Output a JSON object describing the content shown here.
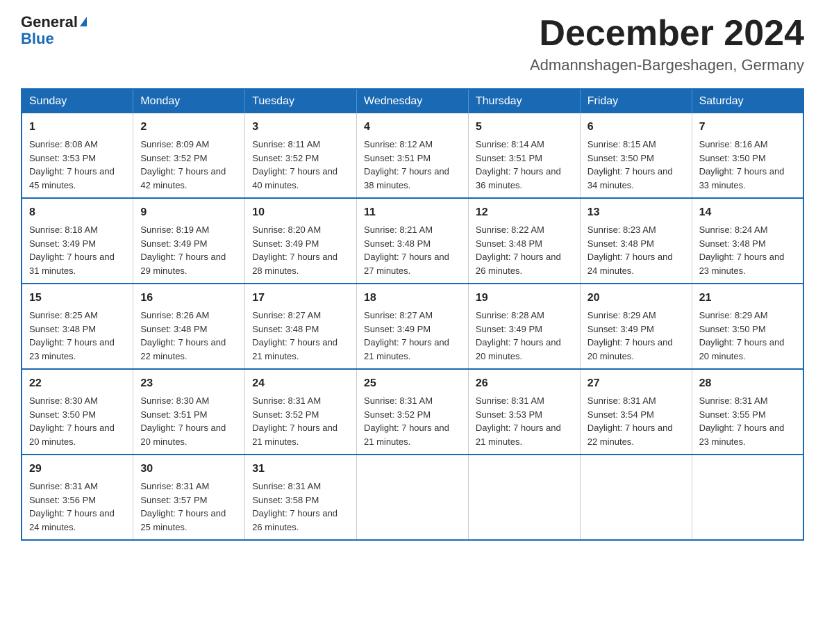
{
  "logo": {
    "general": "General",
    "blue": "Blue"
  },
  "title": "December 2024",
  "location": "Admannshagen-Bargeshagen, Germany",
  "days_of_week": [
    "Sunday",
    "Monday",
    "Tuesday",
    "Wednesday",
    "Thursday",
    "Friday",
    "Saturday"
  ],
  "weeks": [
    [
      {
        "day": "1",
        "sunrise": "8:08 AM",
        "sunset": "3:53 PM",
        "daylight": "7 hours and 45 minutes."
      },
      {
        "day": "2",
        "sunrise": "8:09 AM",
        "sunset": "3:52 PM",
        "daylight": "7 hours and 42 minutes."
      },
      {
        "day": "3",
        "sunrise": "8:11 AM",
        "sunset": "3:52 PM",
        "daylight": "7 hours and 40 minutes."
      },
      {
        "day": "4",
        "sunrise": "8:12 AM",
        "sunset": "3:51 PM",
        "daylight": "7 hours and 38 minutes."
      },
      {
        "day": "5",
        "sunrise": "8:14 AM",
        "sunset": "3:51 PM",
        "daylight": "7 hours and 36 minutes."
      },
      {
        "day": "6",
        "sunrise": "8:15 AM",
        "sunset": "3:50 PM",
        "daylight": "7 hours and 34 minutes."
      },
      {
        "day": "7",
        "sunrise": "8:16 AM",
        "sunset": "3:50 PM",
        "daylight": "7 hours and 33 minutes."
      }
    ],
    [
      {
        "day": "8",
        "sunrise": "8:18 AM",
        "sunset": "3:49 PM",
        "daylight": "7 hours and 31 minutes."
      },
      {
        "day": "9",
        "sunrise": "8:19 AM",
        "sunset": "3:49 PM",
        "daylight": "7 hours and 29 minutes."
      },
      {
        "day": "10",
        "sunrise": "8:20 AM",
        "sunset": "3:49 PM",
        "daylight": "7 hours and 28 minutes."
      },
      {
        "day": "11",
        "sunrise": "8:21 AM",
        "sunset": "3:48 PM",
        "daylight": "7 hours and 27 minutes."
      },
      {
        "day": "12",
        "sunrise": "8:22 AM",
        "sunset": "3:48 PM",
        "daylight": "7 hours and 26 minutes."
      },
      {
        "day": "13",
        "sunrise": "8:23 AM",
        "sunset": "3:48 PM",
        "daylight": "7 hours and 24 minutes."
      },
      {
        "day": "14",
        "sunrise": "8:24 AM",
        "sunset": "3:48 PM",
        "daylight": "7 hours and 23 minutes."
      }
    ],
    [
      {
        "day": "15",
        "sunrise": "8:25 AM",
        "sunset": "3:48 PM",
        "daylight": "7 hours and 23 minutes."
      },
      {
        "day": "16",
        "sunrise": "8:26 AM",
        "sunset": "3:48 PM",
        "daylight": "7 hours and 22 minutes."
      },
      {
        "day": "17",
        "sunrise": "8:27 AM",
        "sunset": "3:48 PM",
        "daylight": "7 hours and 21 minutes."
      },
      {
        "day": "18",
        "sunrise": "8:27 AM",
        "sunset": "3:49 PM",
        "daylight": "7 hours and 21 minutes."
      },
      {
        "day": "19",
        "sunrise": "8:28 AM",
        "sunset": "3:49 PM",
        "daylight": "7 hours and 20 minutes."
      },
      {
        "day": "20",
        "sunrise": "8:29 AM",
        "sunset": "3:49 PM",
        "daylight": "7 hours and 20 minutes."
      },
      {
        "day": "21",
        "sunrise": "8:29 AM",
        "sunset": "3:50 PM",
        "daylight": "7 hours and 20 minutes."
      }
    ],
    [
      {
        "day": "22",
        "sunrise": "8:30 AM",
        "sunset": "3:50 PM",
        "daylight": "7 hours and 20 minutes."
      },
      {
        "day": "23",
        "sunrise": "8:30 AM",
        "sunset": "3:51 PM",
        "daylight": "7 hours and 20 minutes."
      },
      {
        "day": "24",
        "sunrise": "8:31 AM",
        "sunset": "3:52 PM",
        "daylight": "7 hours and 21 minutes."
      },
      {
        "day": "25",
        "sunrise": "8:31 AM",
        "sunset": "3:52 PM",
        "daylight": "7 hours and 21 minutes."
      },
      {
        "day": "26",
        "sunrise": "8:31 AM",
        "sunset": "3:53 PM",
        "daylight": "7 hours and 21 minutes."
      },
      {
        "day": "27",
        "sunrise": "8:31 AM",
        "sunset": "3:54 PM",
        "daylight": "7 hours and 22 minutes."
      },
      {
        "day": "28",
        "sunrise": "8:31 AM",
        "sunset": "3:55 PM",
        "daylight": "7 hours and 23 minutes."
      }
    ],
    [
      {
        "day": "29",
        "sunrise": "8:31 AM",
        "sunset": "3:56 PM",
        "daylight": "7 hours and 24 minutes."
      },
      {
        "day": "30",
        "sunrise": "8:31 AM",
        "sunset": "3:57 PM",
        "daylight": "7 hours and 25 minutes."
      },
      {
        "day": "31",
        "sunrise": "8:31 AM",
        "sunset": "3:58 PM",
        "daylight": "7 hours and 26 minutes."
      },
      null,
      null,
      null,
      null
    ]
  ],
  "labels": {
    "sunrise": "Sunrise:",
    "sunset": "Sunset:",
    "daylight": "Daylight:"
  }
}
